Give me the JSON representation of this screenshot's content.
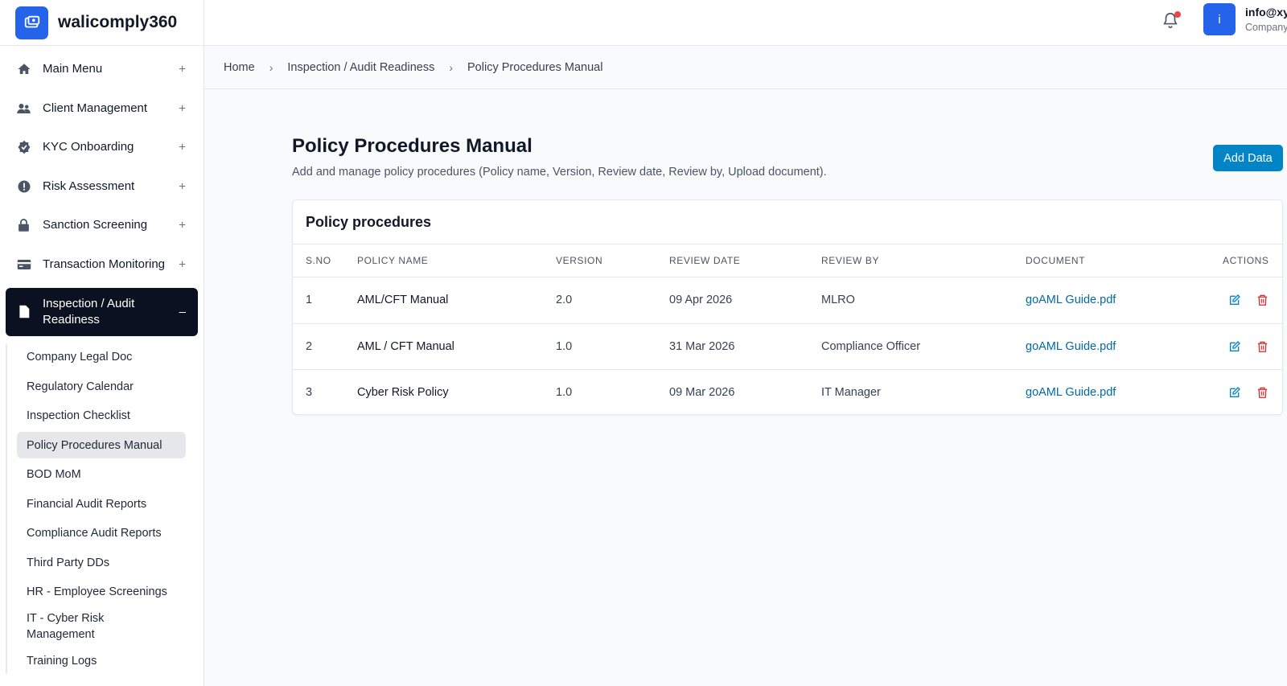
{
  "brand": {
    "name": "walicomply360"
  },
  "nav": {
    "items": [
      {
        "label": "Main Menu",
        "toggle": "+"
      },
      {
        "label": "Client Management",
        "toggle": "+"
      },
      {
        "label": "KYC Onboarding",
        "toggle": "+"
      },
      {
        "label": "Risk Assessment",
        "toggle": "+"
      },
      {
        "label": "Sanction Screening",
        "toggle": "+"
      },
      {
        "label": "Transaction Monitoring",
        "toggle": "+"
      },
      {
        "label": "Inspection / Audit Readiness",
        "toggle": "–"
      }
    ],
    "sub_items": [
      {
        "label": "Company Legal Doc"
      },
      {
        "label": "Regulatory Calendar"
      },
      {
        "label": "Inspection Checklist"
      },
      {
        "label": "Policy Procedures Manual"
      },
      {
        "label": "BOD MoM"
      },
      {
        "label": "Financial Audit Reports"
      },
      {
        "label": "Compliance Audit Reports"
      },
      {
        "label": "Third Party DDs"
      },
      {
        "label": "HR - Employee Screenings"
      },
      {
        "label": "IT - Cyber Risk Management"
      },
      {
        "label": "Training Logs"
      }
    ]
  },
  "user": {
    "avatar_letter": "i",
    "email": "info@xy",
    "company": "Company"
  },
  "breadcrumb": [
    "Home",
    "Inspection / Audit Readiness",
    "Policy Procedures Manual"
  ],
  "page": {
    "title": "Policy Procedures Manual",
    "subtitle": "Add and manage policy procedures (Policy name, Version, Review date, Review by, Upload document).",
    "add_button": "Add Data"
  },
  "table": {
    "title": "Policy procedures",
    "columns": [
      "S.NO",
      "POLICY NAME",
      "VERSION",
      "REVIEW DATE",
      "REVIEW BY",
      "DOCUMENT",
      "ACTIONS"
    ],
    "rows": [
      {
        "sno": "1",
        "name": "AML/CFT Manual",
        "version": "2.0",
        "review_date": "09 Apr 2026",
        "review_by": "MLRO",
        "document": "goAML Guide.pdf"
      },
      {
        "sno": "2",
        "name": "AML / CFT Manual",
        "version": "1.0",
        "review_date": "31 Mar 2026",
        "review_by": "Compliance Officer",
        "document": "goAML Guide.pdf"
      },
      {
        "sno": "3",
        "name": "Cyber Risk Policy",
        "version": "1.0",
        "review_date": "09 Mar 2026",
        "review_by": "IT Manager",
        "document": "goAML Guide.pdf"
      }
    ]
  },
  "colors": {
    "accent": "#2563eb",
    "button": "#0284c7",
    "active_nav": "#0b1120",
    "link": "#0369a1",
    "delete": "#dc2626",
    "edit": "#0284c7"
  },
  "icons": {
    "nav": [
      "home-icon",
      "users-icon",
      "badge-check-icon",
      "alert-circle-icon",
      "lock-icon",
      "credit-card-icon",
      "document-icon"
    ],
    "edit": "edit-icon",
    "delete": "trash-icon",
    "bell": "bell-icon"
  }
}
